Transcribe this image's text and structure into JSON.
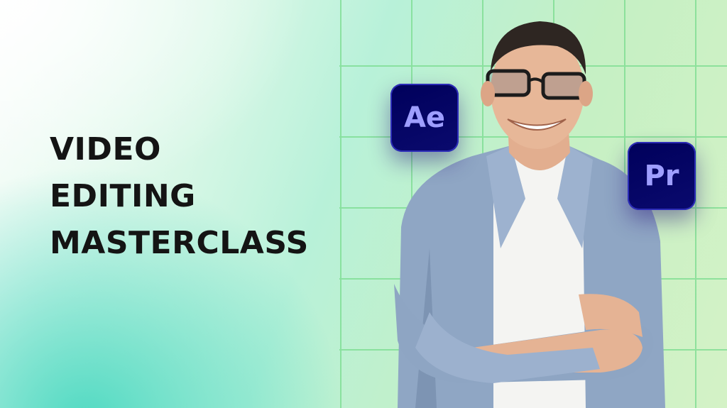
{
  "banner": {
    "headline": [
      "VIDEO",
      "EDITING",
      "MASTERCLASS"
    ],
    "colors": {
      "accent_green": "#79dc8e",
      "teal": "#40d6be",
      "icon_bg": "#00005b",
      "icon_text": "#9e9eff"
    },
    "icons": [
      {
        "name": "after-effects-icon",
        "label": "Ae"
      },
      {
        "name": "premiere-pro-icon",
        "label": "Pr"
      }
    ]
  }
}
